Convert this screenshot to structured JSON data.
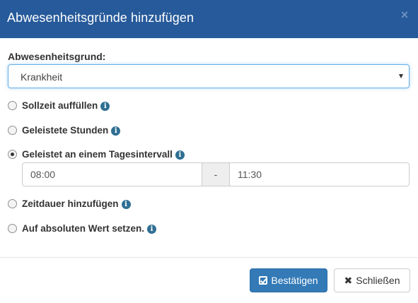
{
  "modal": {
    "title": "Abwesenheitsgründe hinzufügen",
    "close_glyph": "×",
    "header_color": "#265a9a"
  },
  "reason": {
    "label": "Abwesenheitsgrund:",
    "selected": "Krankheit"
  },
  "options": [
    {
      "label": "Sollzeit auffüllen",
      "checked": false,
      "info_icon": "info-circle-icon"
    },
    {
      "label": "Geleistete Stunden",
      "checked": false,
      "info_icon": "info-circle-icon"
    },
    {
      "label": "Geleistet an einem Tagesintervall",
      "checked": true,
      "info_icon": "info-circle-icon"
    },
    {
      "label": "Zeitdauer hinzufügen",
      "checked": false,
      "info_icon": "info-circle-icon"
    },
    {
      "label": "Auf absoluten Wert setzen.",
      "checked": false,
      "info_icon": "info-circle-icon"
    }
  ],
  "interval": {
    "from": "08:00",
    "separator": "-",
    "to": "11:30"
  },
  "buttons": {
    "confirm": "Bestätigen",
    "close": "Schließen",
    "confirm_color": "#337ab7"
  }
}
